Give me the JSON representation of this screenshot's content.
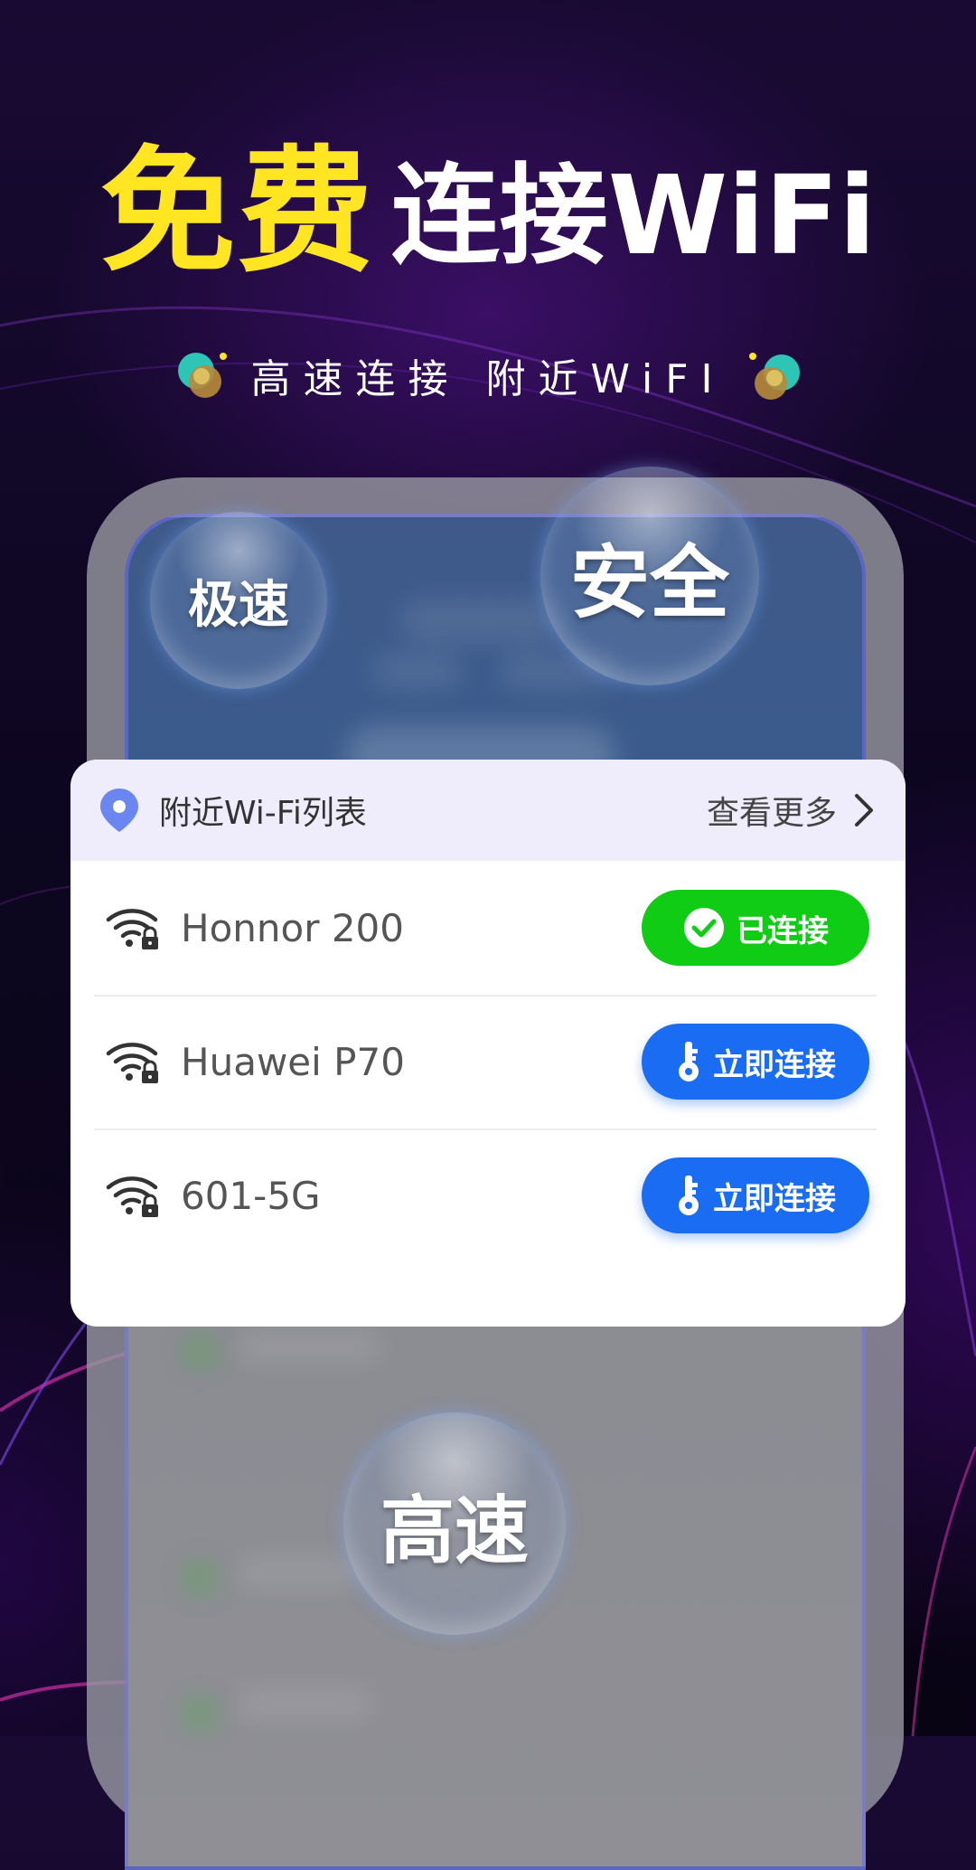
{
  "headline": {
    "yellow": "免费",
    "white": "连接WiFi"
  },
  "subline": "高速连接 附近WiFI",
  "bubbles": {
    "top_left": "极速",
    "top_right": "安全",
    "bottom": "高速"
  },
  "card": {
    "title": "附近Wi-Fi列表",
    "more_label": "查看更多",
    "networks": [
      {
        "name": "Honnor 200",
        "action": "已连接",
        "status": "connected"
      },
      {
        "name": "Huawei P70",
        "action": "立即连接",
        "status": "available"
      },
      {
        "name": "601-5G",
        "action": "立即连接",
        "status": "available"
      }
    ]
  },
  "colors": {
    "accent_yellow": "#ffe522",
    "connected_green": "#10cc14",
    "connect_blue": "#1a6cf2",
    "location_pin": "#6b86f0"
  },
  "icons": [
    "location-pin-icon",
    "chevron-right-icon",
    "wifi-lock-icon",
    "check-circle-icon",
    "key-icon",
    "orb-icon"
  ]
}
